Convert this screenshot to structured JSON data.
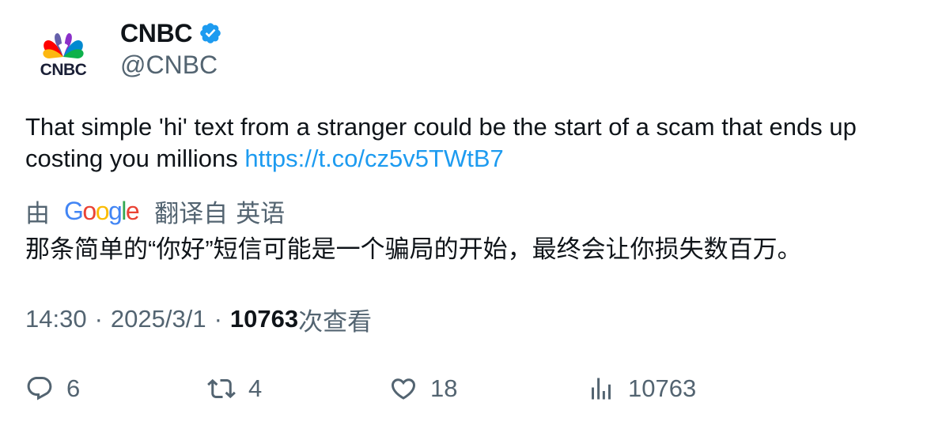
{
  "author": {
    "display_name": "CNBC",
    "handle": "@CNBC",
    "avatar_logo_text": "CNBC",
    "verified": true
  },
  "tweet": {
    "text": "That simple 'hi' text from a stranger could be the start of a scam that ends up costing you millions ",
    "link": "https://t.co/cz5v5TWtB7"
  },
  "translation": {
    "by_label": "由",
    "provider": "Google",
    "from_label": "翻译自",
    "language": "英语",
    "text": "那条简单的“你好”短信可能是一个骗局的开始，最终会让你损失数百万。"
  },
  "meta": {
    "time": "14:30",
    "separator": "·",
    "date": "2025/3/1",
    "views_count": "10763",
    "views_label": "次查看"
  },
  "actions": {
    "replies": "6",
    "retweets": "4",
    "likes": "18",
    "views": "10763"
  },
  "colors": {
    "text": "#0f1419",
    "secondary": "#536471",
    "link": "#1d9bf0",
    "verified": "#1d9bf0"
  }
}
